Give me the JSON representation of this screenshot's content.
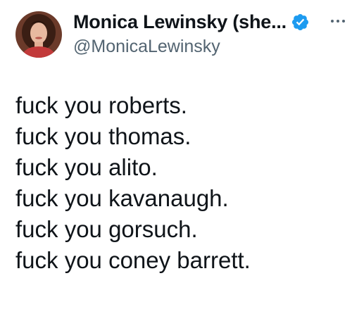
{
  "author": {
    "display_name": "Monica Lewinsky (she...",
    "handle": "@MonicaLewinsky",
    "verified": true,
    "verified_color": "#1d9bf0",
    "avatar_icon": "profile-photo"
  },
  "more_menu_icon": "ellipsis-icon",
  "tweet": {
    "lines": [
      "fuck you roberts.",
      "fuck you thomas.",
      "fuck you alito.",
      "fuck you kavanaugh.",
      "fuck you gorsuch.",
      "fuck you coney barrett."
    ]
  }
}
